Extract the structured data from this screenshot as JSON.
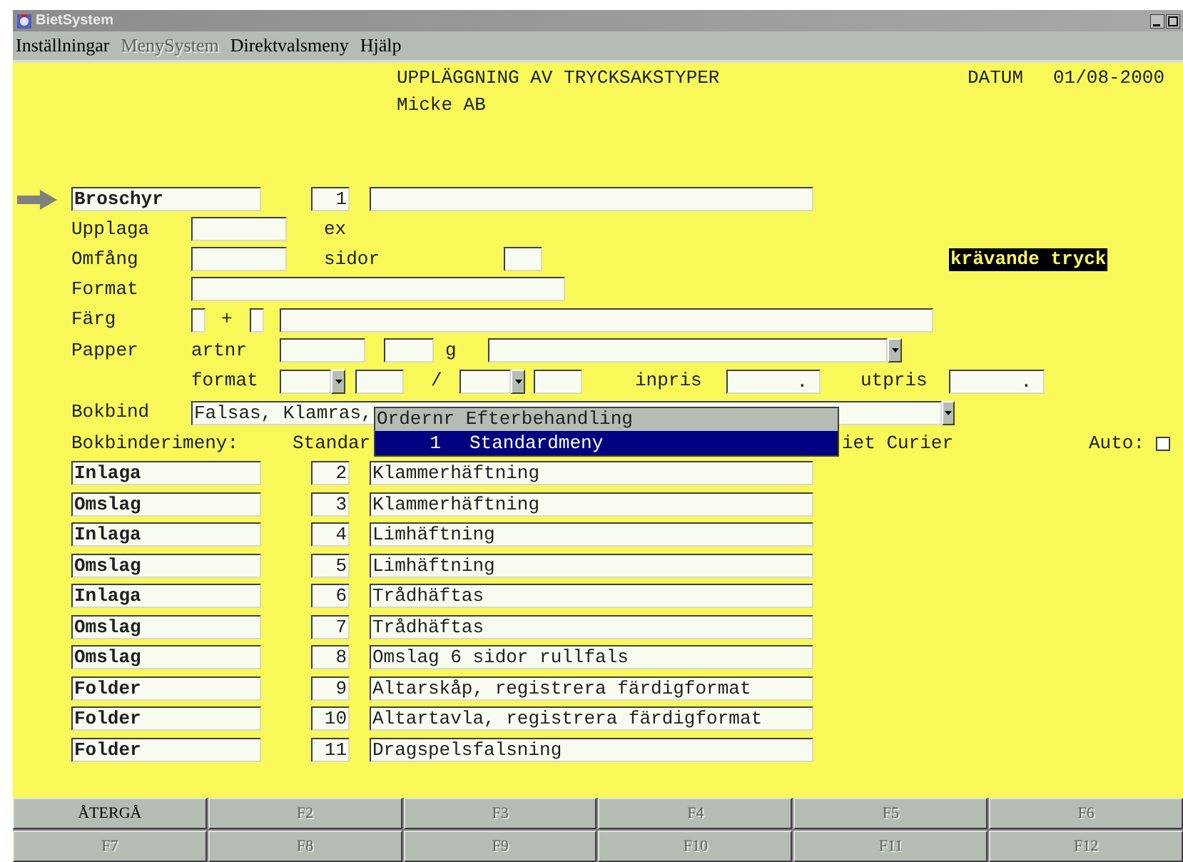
{
  "window": {
    "title": "BietSystem"
  },
  "menu": [
    {
      "label": "Inställningar",
      "disabled": false
    },
    {
      "label": "MenySystem",
      "disabled": true
    },
    {
      "label": "Direktvalsmeny",
      "disabled": false
    },
    {
      "label": "Hjälp",
      "disabled": false
    }
  ],
  "header": {
    "title": "UPPLÄGGNING AV TRYCKSAKSTYPER",
    "company": "Micke AB",
    "date_label": "DATUM",
    "date": "01/08-2000"
  },
  "product": {
    "name": "Broschyr",
    "number": "1"
  },
  "upplaga": {
    "label": "Upplaga",
    "unit": "ex"
  },
  "omfang": {
    "label": "Omfång",
    "unit": "sidor"
  },
  "badge": "krävande tryck",
  "format": {
    "label": "Format"
  },
  "farg": {
    "label": "Färg",
    "plus": "+"
  },
  "papper": {
    "label": "Papper",
    "artnr_label": "artnr",
    "weight_unit": "g",
    "format_label": "format",
    "slash": "/",
    "inpris_label": "inpris",
    "inpris": ".",
    "utpris_label": "utpris",
    "utpris": "."
  },
  "bokbind": {
    "label": "Bokbind",
    "value": "Falsas, Klamras,"
  },
  "bokbinderimeny": {
    "label": "Bokbinderimeny:",
    "value": "Standar",
    "printer": "iet Curier",
    "auto_label": "Auto:",
    "auto": false
  },
  "popup": {
    "header": "Ordernr Efterbehandling",
    "items": [
      {
        "number": "1",
        "label": "Standardmeny",
        "selected": true
      }
    ]
  },
  "rows": [
    {
      "part": "Inlaga",
      "number": "2",
      "description": "Klammerhäftning"
    },
    {
      "part": "Omslag",
      "number": "3",
      "description": "Klammerhäftning"
    },
    {
      "part": "Inlaga",
      "number": "4",
      "description": "Limhäftning"
    },
    {
      "part": "Omslag",
      "number": "5",
      "description": "Limhäftning"
    },
    {
      "part": "Inlaga",
      "number": "6",
      "description": "Trådhäftas"
    },
    {
      "part": "Omslag",
      "number": "7",
      "description": "Trådhäftas"
    },
    {
      "part": "Omslag",
      "number": "8",
      "description": "Omslag 6 sidor rullfals"
    },
    {
      "part": "Folder",
      "number": "9",
      "description": "Altarskåp, registrera färdigformat"
    },
    {
      "part": "Folder",
      "number": "10",
      "description": "Altartavla, registrera färdigformat"
    },
    {
      "part": "Folder",
      "number": "11",
      "description": "Dragspelsfalsning"
    }
  ],
  "function_keys": [
    {
      "label": "ÅTERGÅ",
      "disabled": false
    },
    {
      "label": "F2",
      "disabled": true
    },
    {
      "label": "F3",
      "disabled": true
    },
    {
      "label": "F4",
      "disabled": true
    },
    {
      "label": "F5",
      "disabled": true
    },
    {
      "label": "F6",
      "disabled": true
    },
    {
      "label": "F7",
      "disabled": true
    },
    {
      "label": "F8",
      "disabled": true
    },
    {
      "label": "F9",
      "disabled": true
    },
    {
      "label": "F10",
      "disabled": true
    },
    {
      "label": "F11",
      "disabled": true
    },
    {
      "label": "F12",
      "disabled": true
    }
  ]
}
